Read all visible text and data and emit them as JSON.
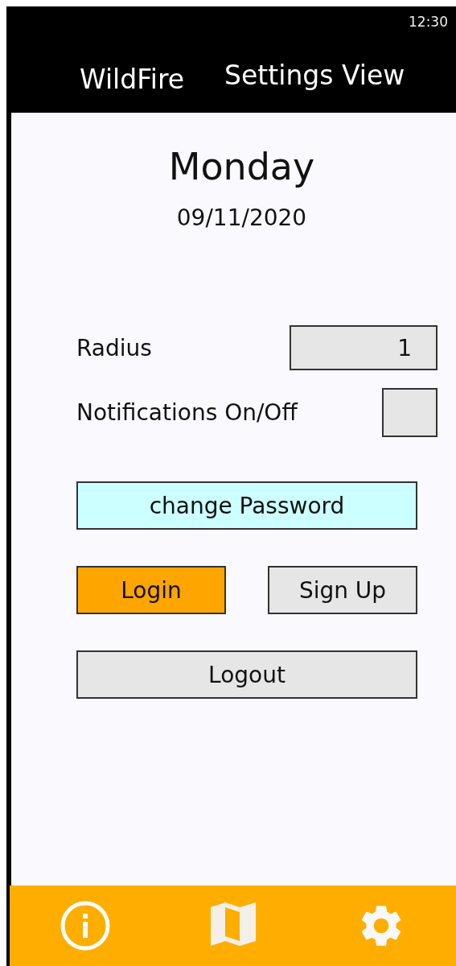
{
  "status_bar": {
    "time": "12:30"
  },
  "header": {
    "app_name": "WildFire",
    "view_title": "Settings View"
  },
  "day": "Monday",
  "date": "09/11/2020",
  "radius": {
    "label": "Radius",
    "value": "1"
  },
  "notifications": {
    "label": "Notifications On/Off",
    "checked": false
  },
  "buttons": [
    {
      "label": "change Password",
      "kind": "wide",
      "color": "#ccffff"
    },
    {
      "label": "Login",
      "kind": "half",
      "color": "#ffa500"
    },
    {
      "label": "Sign Up",
      "kind": "half",
      "color": "#e6e6e6"
    },
    {
      "label": "Logout",
      "kind": "wide",
      "color": "#e6e6e6"
    }
  ],
  "bottom_nav": [
    {
      "kind": "info"
    },
    {
      "kind": "map"
    },
    {
      "kind": "settings"
    }
  ]
}
